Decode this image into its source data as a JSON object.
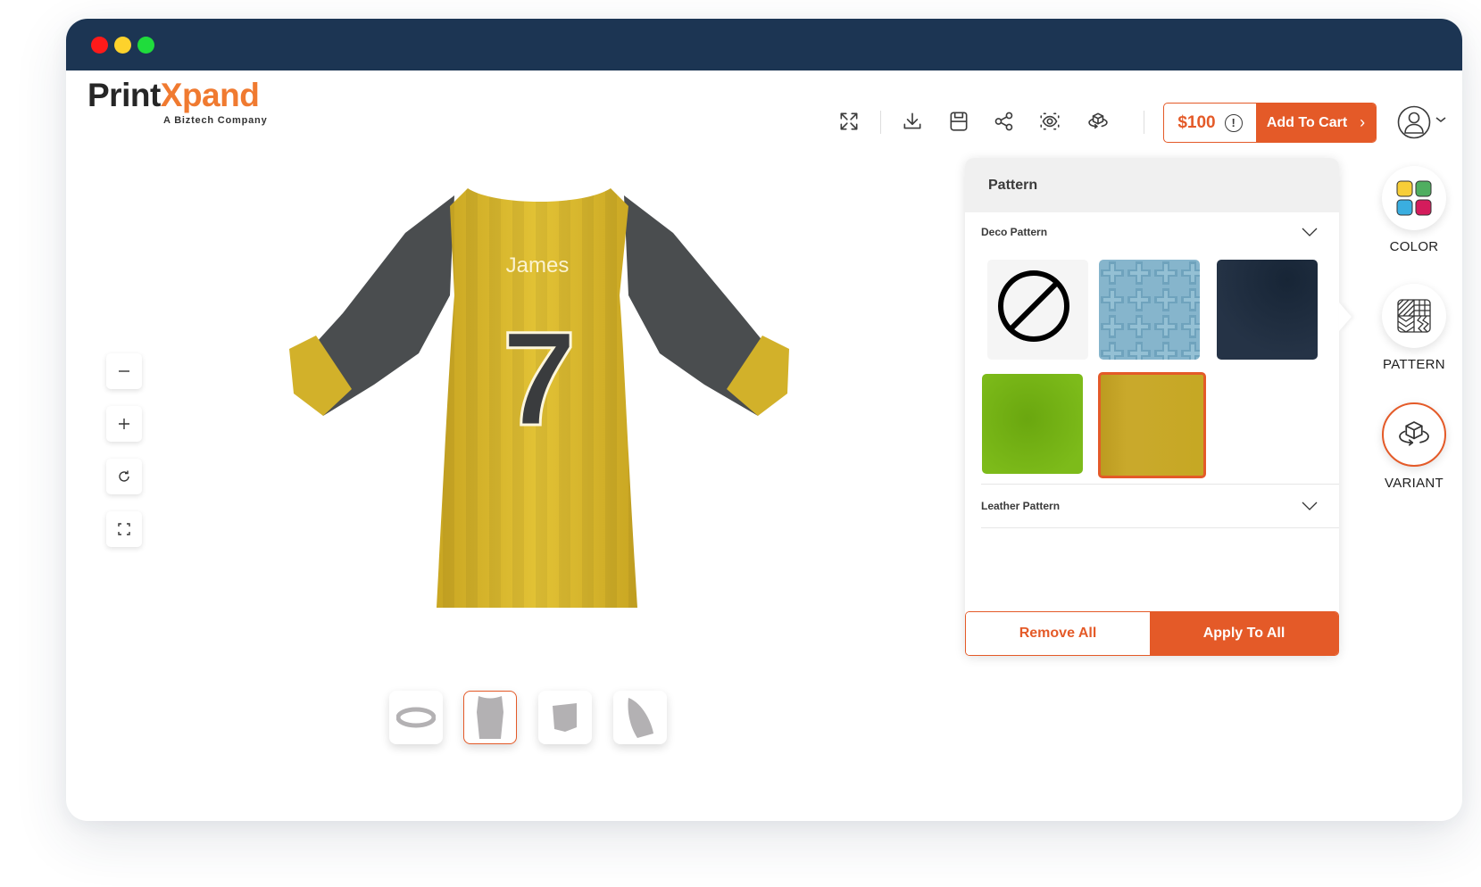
{
  "app": {
    "brand": {
      "name_part1": "Print",
      "name_part2": "Xpand",
      "tagline": "A Biztech Company"
    }
  },
  "toolbar": {
    "icons": [
      "fullscreen-icon",
      "download-icon",
      "save-icon",
      "share-icon",
      "preview-icon",
      "3d-view-icon"
    ],
    "price": "$100",
    "price_info_glyph": "!",
    "add_to_cart_label": "Add To Cart",
    "add_to_cart_chevron": "›"
  },
  "viewer": {
    "controls": [
      "zoom-out",
      "zoom-in",
      "reset-rotation",
      "fit-screen"
    ],
    "jersey": {
      "name": "James",
      "number": "7",
      "body_color": "#d7b62c",
      "sleeve_color": "#4a4d4f"
    },
    "parts": [
      {
        "name": "collar",
        "active": false
      },
      {
        "name": "body",
        "active": true
      },
      {
        "name": "pocket",
        "active": false
      },
      {
        "name": "sleeve",
        "active": false
      }
    ]
  },
  "pattern_panel": {
    "title": "Pattern",
    "sections": [
      {
        "label": "Deco Pattern",
        "expanded": true
      },
      {
        "label": "Leather Pattern",
        "expanded": false
      }
    ],
    "swatches": [
      {
        "name": "none",
        "selected": false
      },
      {
        "name": "blue-cross",
        "selected": false
      },
      {
        "name": "dark-navy",
        "selected": false
      },
      {
        "name": "green",
        "selected": false
      },
      {
        "name": "mustard-yellow",
        "selected": true
      }
    ],
    "remove_all_label": "Remove All",
    "apply_all_label": "Apply To All"
  },
  "right_rail": {
    "items": [
      {
        "label": "COLOR",
        "active": false
      },
      {
        "label": "PATTERN",
        "active": false
      },
      {
        "label": "VARIANT",
        "active": true
      }
    ]
  },
  "colors": {
    "accent": "#e45a28",
    "titlebar": "#1c3553",
    "logo_orange": "#f07a30"
  }
}
